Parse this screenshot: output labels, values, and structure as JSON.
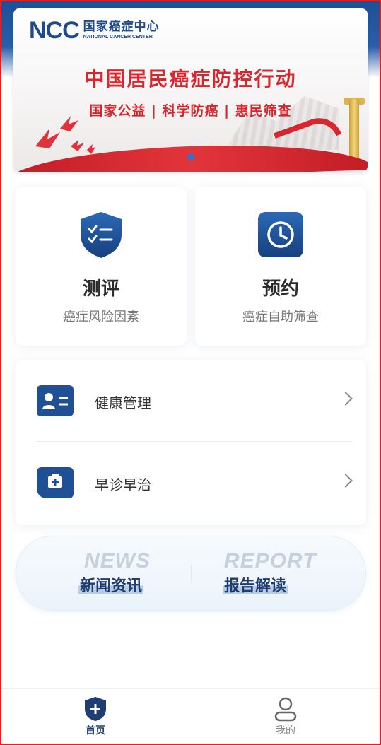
{
  "banner": {
    "logo_mark": "NCC",
    "logo_cn": "国家癌症中心",
    "logo_en": "NATIONAL CANCER CENTER",
    "title": "中国居民癌症防控行动",
    "subtitle": "国家公益 | 科学防癌 | 惠民筛查"
  },
  "cards": {
    "assess": {
      "title": "测评",
      "subtitle": "癌症风险因素",
      "icon": "shield-checklist-icon"
    },
    "book": {
      "title": "预约",
      "subtitle": "癌症自助筛查",
      "icon": "clock-icon"
    }
  },
  "list": [
    {
      "label": "健康管理",
      "icon": "id-card-icon"
    },
    {
      "label": "早诊早治",
      "icon": "medical-kit-icon"
    }
  ],
  "shortcuts": {
    "news": {
      "en": "NEWS",
      "cn": "新闻资讯"
    },
    "report": {
      "en": "REPORT",
      "cn": "报告解读"
    }
  },
  "tabbar": {
    "home": "首页",
    "me": "我的"
  },
  "colors": {
    "brand_blue": "#1f4a8c",
    "brand_red": "#d8262e",
    "active_dot": "#2577d8"
  }
}
